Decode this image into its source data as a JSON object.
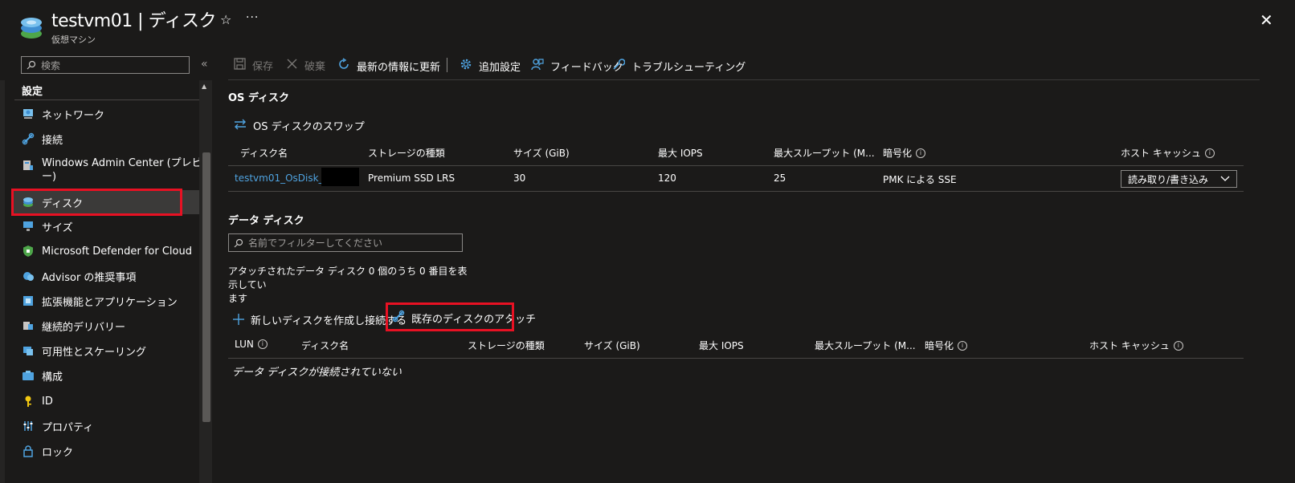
{
  "header": {
    "title": "testvm01 | ディスク",
    "subtitle": "仮想マシン",
    "star_icon": "☆",
    "more_icon": "···",
    "close_icon": "✕"
  },
  "nav": {
    "search_placeholder": "検索",
    "collapse_icon": "«",
    "section_title": "設定",
    "items": [
      {
        "label": "ネットワーク",
        "icon": "network-icon"
      },
      {
        "label": "接続",
        "icon": "connect-icon"
      },
      {
        "label": "Windows Admin Center (プレビュー)",
        "icon": "admin-center-icon"
      },
      {
        "label": "ディスク",
        "icon": "disk-icon"
      },
      {
        "label": "サイズ",
        "icon": "size-icon"
      },
      {
        "label": "Microsoft Defender for Cloud",
        "icon": "defender-icon"
      },
      {
        "label": "Advisor の推奨事項",
        "icon": "advisor-icon"
      },
      {
        "label": "拡張機能とアプリケーション",
        "icon": "extensions-icon"
      },
      {
        "label": "継続的デリバリー",
        "icon": "delivery-icon"
      },
      {
        "label": "可用性とスケーリング",
        "icon": "availability-icon"
      },
      {
        "label": "構成",
        "icon": "configuration-icon"
      },
      {
        "label": "ID",
        "icon": "identity-icon"
      },
      {
        "label": "プロパティ",
        "icon": "properties-icon"
      },
      {
        "label": "ロック",
        "icon": "lock-icon"
      }
    ],
    "item_windows_admin_line1": "Windows Admin Center (プレビュ",
    "item_windows_admin_line2": "ー)"
  },
  "toolbar": {
    "save": "保存",
    "discard": "破棄",
    "refresh": "最新の情報に更新",
    "additional_settings": "追加設定",
    "feedback": "フィードバック",
    "troubleshoot": "トラブルシューティング"
  },
  "os_disk": {
    "title": "OS ディスク",
    "swap": "OS ディスクのスワップ",
    "columns": [
      "ディスク名",
      "ストレージの種類",
      "サイズ (GiB)",
      "最大 IOPS",
      "最大スループット (M...",
      "暗号化",
      "ホスト キャッシュ"
    ],
    "row": {
      "name": "testvm01_OsDisk_1_",
      "storage": "Premium SSD LRS",
      "size": "30",
      "iops": "120",
      "throughput": "25",
      "encryption": "PMK による SSE",
      "cache": "読み取り/書き込み"
    }
  },
  "data_disk": {
    "title": "データ ディスク",
    "filter_placeholder": "名前でフィルターしてください",
    "count_line1": "アタッチされたデータ ディスク 0 個のうち 0 番目を表示してい",
    "count_line2": "ます",
    "add_new": "新しいディスクを作成し接続する",
    "attach_existing": "既存のディスクのアタッチ",
    "columns": [
      "LUN",
      "ディスク名",
      "ストレージの種類",
      "サイズ (GiB)",
      "最大 IOPS",
      "最大スループット (M...",
      "暗号化",
      "ホスト キャッシュ"
    ],
    "empty": "データ ディスクが接続されていない"
  },
  "colors": {
    "background": "#1b1a19",
    "accent": "#4fa3e0",
    "highlight": "#e81123"
  }
}
